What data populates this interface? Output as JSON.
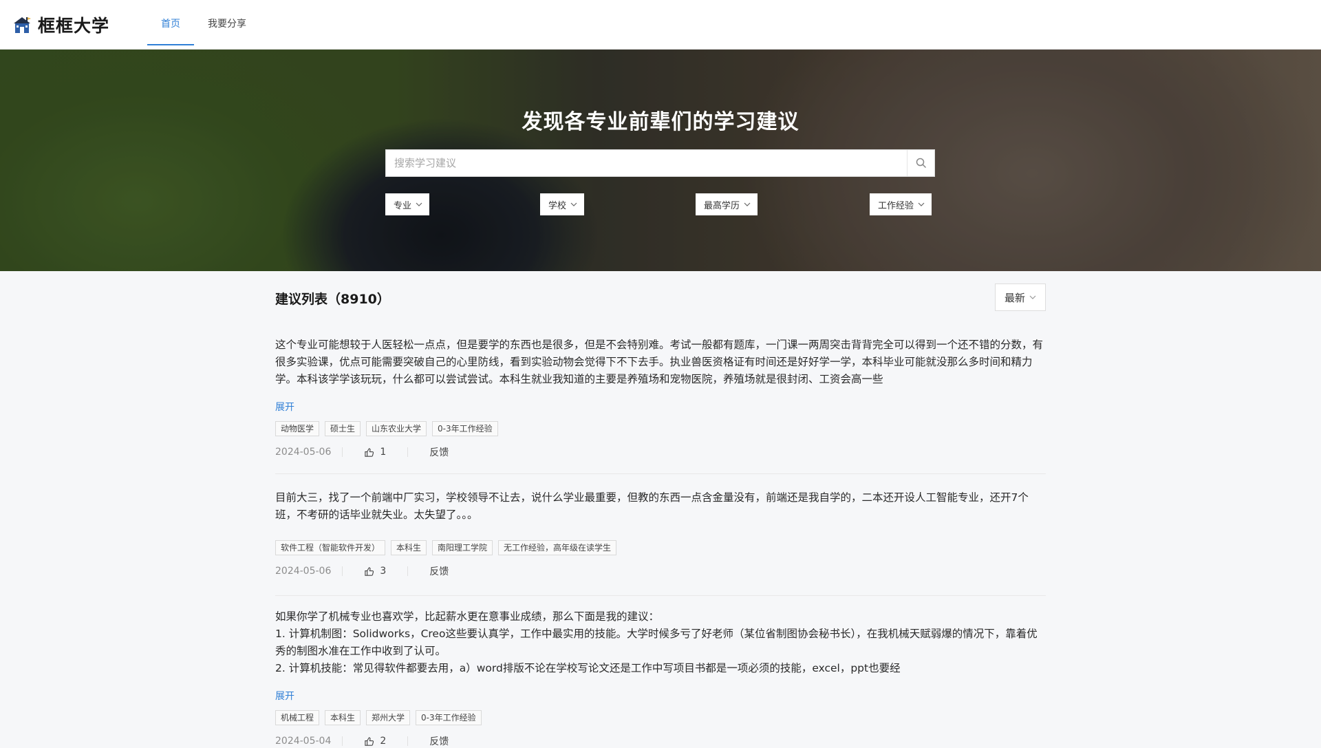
{
  "header": {
    "logo_text": "框框大学",
    "nav": [
      "首页",
      "我要分享"
    ]
  },
  "hero": {
    "title": "发现各专业前辈们的学习建议",
    "search_placeholder": "搜索学习建议",
    "filters": [
      "专业",
      "学校",
      "最高学历",
      "工作经验"
    ]
  },
  "list": {
    "title": "建议列表（8910）",
    "sort_label": "最新",
    "expand_label": "展开",
    "feedback_label": "反馈",
    "items": [
      {
        "text": "这个专业可能想较于人医轻松一点点，但是要学的东西也是很多，但是不会特别难。考试一般都有题库，一门课一两周突击背背完全可以得到一个还不错的分数，有很多实验课，优点可能需要突破自己的心里防线，看到实验动物会觉得下不下去手。执业兽医资格证有时间还是好好学一学，本科毕业可能就没那么多时间和精力学。本科该学学该玩玩，什么都可以尝试尝试。本科生就业我知道的主要是养殖场和宠物医院，养殖场就是很封闭、工资会高一些",
        "tags": [
          "动物医学",
          "硕士生",
          "山东农业大学",
          "0-3年工作经验"
        ],
        "date": "2024-05-06",
        "likes": "1"
      },
      {
        "text": "目前大三，找了一个前端中厂实习，学校领导不让去，说什么学业最重要，但教的东西一点含金量没有，前端还是我自学的，二本还开设人工智能专业，还开7个班，不考研的话毕业就失业。太失望了。。。",
        "tags": [
          "软件工程（智能软件开发）",
          "本科生",
          "南阳理工学院",
          "无工作经验，高年级在读学生"
        ],
        "date": "2024-05-06",
        "likes": "3"
      },
      {
        "lines": [
          "如果你学了机械专业也喜欢学，比起薪水更在意事业成绩，那么下面是我的建议：",
          "1. 计算机制图：Solidworks，Creo这些要认真学，工作中最实用的技能。大学时候多亏了好老师（某位省制图协会秘书长），在我机械天赋弱爆的情况下，靠着优秀的制图水准在工作中收到了认可。",
          "2. 计算机技能：常见得软件都要去用，a）word排版不论在学校写论文还是工作中写项目书都是一项必须的技能，excel，ppt也要经"
        ],
        "tags": [
          "机械工程",
          "本科生",
          "郑州大学",
          "0-3年工作经验"
        ],
        "date": "2024-05-04",
        "likes": "2"
      }
    ]
  },
  "colors": {
    "accent": "#2f7fd6"
  }
}
